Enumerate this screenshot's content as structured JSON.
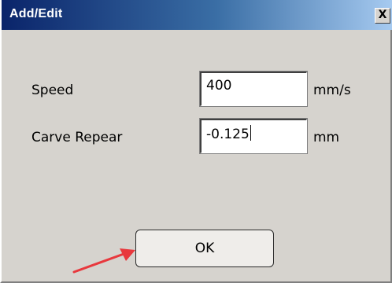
{
  "window": {
    "title": "Add/Edit",
    "close_label": "X"
  },
  "form": {
    "speed": {
      "label": "Speed",
      "value": "400",
      "unit": "mm/s"
    },
    "carve_repeat": {
      "label": "Carve Repear",
      "value": "-0.125",
      "unit": "mm"
    }
  },
  "actions": {
    "ok_label": "OK"
  },
  "colors": {
    "title_gradient_start": "#0a246a",
    "title_gradient_end": "#a6caf0",
    "dialog_bg": "#d6d3ce",
    "annotation_arrow": "#e8383d"
  },
  "icons": {
    "close": "close-icon",
    "annotation": "red-arrow-icon"
  }
}
